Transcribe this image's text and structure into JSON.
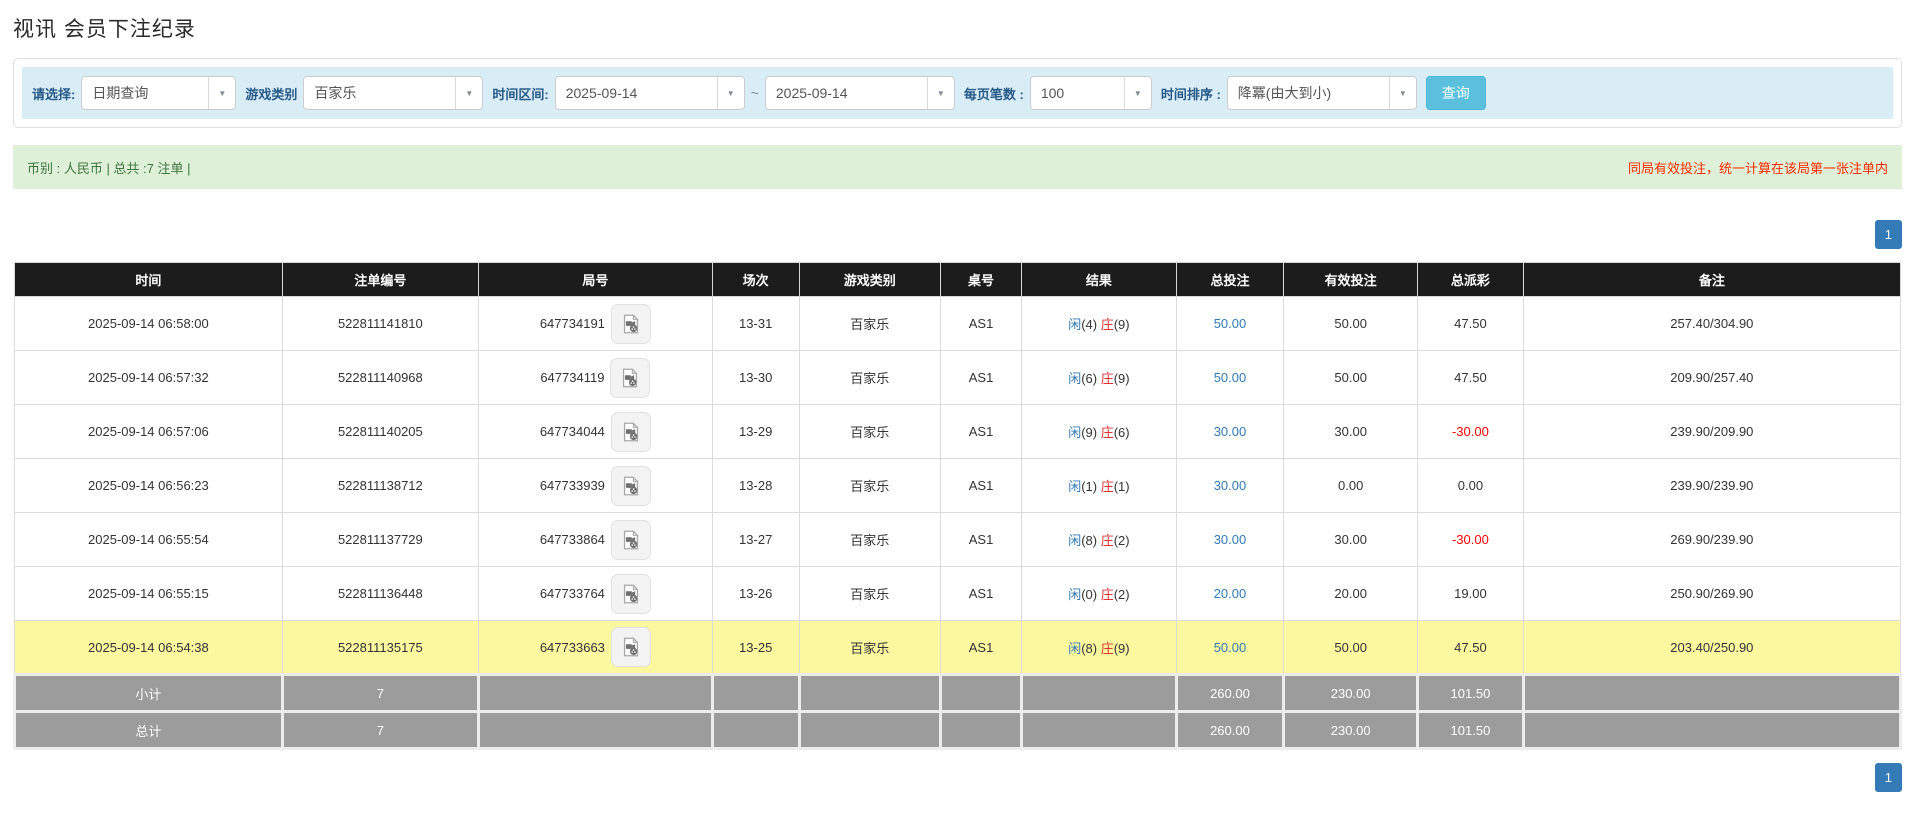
{
  "page": {
    "title": "视讯 会员下注纪录"
  },
  "filters": {
    "mode_label": "请选择:",
    "mode_value": "日期查询",
    "game_label": "游戏类别",
    "game_value": "百家乐",
    "range_label": "时间区间:",
    "date_from": "2025-09-14",
    "tilde": "~",
    "date_to": "2025-09-14",
    "pagesize_label": "每页笔数 :",
    "pagesize_value": "100",
    "sort_label": "时间排序 :",
    "sort_value": "降冪(由大到小)",
    "search_button": "查询"
  },
  "summary": {
    "left": "币别 : 人民币 | 总共 :7 注单 |",
    "right": "同局有效投注，统一计算在该局第一张注单内"
  },
  "pagination": {
    "current_page": "1"
  },
  "table": {
    "headers": [
      "时间",
      "注单编号",
      "局号",
      "场次",
      "游戏类别",
      "桌号",
      "结果",
      "总投注",
      "有效投注",
      "总派彩",
      "备注"
    ],
    "rows": [
      {
        "time": "2025-09-14 06:58:00",
        "bet_id": "522811141810",
        "round_id": "647734191",
        "session": "13-31",
        "game": "百家乐",
        "table_no": "AS1",
        "result": {
          "player_label": "闲",
          "player_score": "(4)",
          "banker_label": "庄",
          "banker_score": "(9)"
        },
        "total_bet": "50.00",
        "valid_bet": "50.00",
        "payout": "47.50",
        "remark": "257.40/304.90",
        "highlight": false
      },
      {
        "time": "2025-09-14 06:57:32",
        "bet_id": "522811140968",
        "round_id": "647734119",
        "session": "13-30",
        "game": "百家乐",
        "table_no": "AS1",
        "result": {
          "player_label": "闲",
          "player_score": "(6)",
          "banker_label": "庄",
          "banker_score": "(9)"
        },
        "total_bet": "50.00",
        "valid_bet": "50.00",
        "payout": "47.50",
        "remark": "209.90/257.40",
        "highlight": false
      },
      {
        "time": "2025-09-14 06:57:06",
        "bet_id": "522811140205",
        "round_id": "647734044",
        "session": "13-29",
        "game": "百家乐",
        "table_no": "AS1",
        "result": {
          "player_label": "闲",
          "player_score": "(9)",
          "banker_label": "庄",
          "banker_score": "(6)"
        },
        "total_bet": "30.00",
        "valid_bet": "30.00",
        "payout": "-30.00",
        "remark": "239.90/209.90",
        "highlight": false
      },
      {
        "time": "2025-09-14 06:56:23",
        "bet_id": "522811138712",
        "round_id": "647733939",
        "session": "13-28",
        "game": "百家乐",
        "table_no": "AS1",
        "result": {
          "player_label": "闲",
          "player_score": "(1)",
          "banker_label": "庄",
          "banker_score": "(1)"
        },
        "total_bet": "30.00",
        "valid_bet": "0.00",
        "payout": "0.00",
        "remark": "239.90/239.90",
        "highlight": false
      },
      {
        "time": "2025-09-14 06:55:54",
        "bet_id": "522811137729",
        "round_id": "647733864",
        "session": "13-27",
        "game": "百家乐",
        "table_no": "AS1",
        "result": {
          "player_label": "闲",
          "player_score": "(8)",
          "banker_label": "庄",
          "banker_score": "(2)"
        },
        "total_bet": "30.00",
        "valid_bet": "30.00",
        "payout": "-30.00",
        "remark": "269.90/239.90",
        "highlight": false
      },
      {
        "time": "2025-09-14 06:55:15",
        "bet_id": "522811136448",
        "round_id": "647733764",
        "session": "13-26",
        "game": "百家乐",
        "table_no": "AS1",
        "result": {
          "player_label": "闲",
          "player_score": "(0)",
          "banker_label": "庄",
          "banker_score": "(2)"
        },
        "total_bet": "20.00",
        "valid_bet": "20.00",
        "payout": "19.00",
        "remark": "250.90/269.90",
        "highlight": false
      },
      {
        "time": "2025-09-14 06:54:38",
        "bet_id": "522811135175",
        "round_id": "647733663",
        "session": "13-25",
        "game": "百家乐",
        "table_no": "AS1",
        "result": {
          "player_label": "闲",
          "player_score": "(8)",
          "banker_label": "庄",
          "banker_score": "(9)"
        },
        "total_bet": "50.00",
        "valid_bet": "50.00",
        "payout": "47.50",
        "remark": "203.40/250.90",
        "highlight": true
      }
    ],
    "subtotal": {
      "label": "小计",
      "count": "7",
      "total_bet": "260.00",
      "valid_bet": "230.00",
      "payout": "101.50"
    },
    "total": {
      "label": "总计",
      "count": "7",
      "total_bet": "260.00",
      "valid_bet": "230.00",
      "payout": "101.50"
    }
  },
  "colors": {
    "accent_blue": "#337ab7",
    "filter_bar_bg": "#d9edf7",
    "filter_label": "#265a88",
    "search_button_bg": "#5bc0de",
    "summary_bg": "#dff0d8",
    "summary_text": "#3c763d",
    "warning_red": "#ff2a00",
    "header_bg": "#1c1c1c",
    "highlight_row_bg": "#fbf8a0",
    "total_row_bg": "#9c9c9c",
    "player_blue": "#337ab7",
    "banker_red": "#e03131",
    "negative_red": "#ff0000"
  }
}
